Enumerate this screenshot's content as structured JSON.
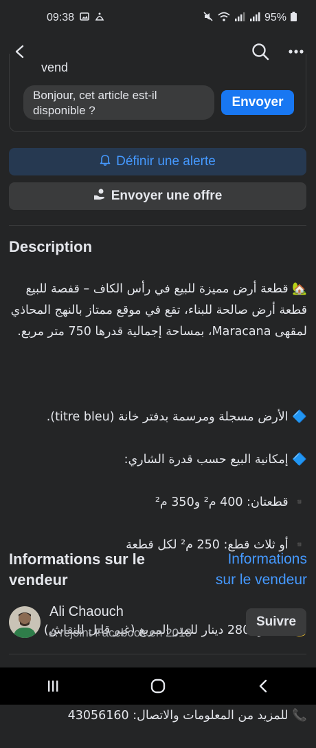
{
  "status_bar": {
    "time": "09:38",
    "battery": "95%"
  },
  "app_bar": {
    "back_icon": "arrow-back-icon",
    "search_icon": "search-icon",
    "more_icon": "more-horizontal-icon"
  },
  "seller_message": {
    "card_label": "vend",
    "message_value": "Bonjour, cet article est-il disponible ?",
    "send_label": "Envoyer"
  },
  "actions": {
    "alert_label": "Définir une alerte",
    "offer_label": "Envoyer une offre"
  },
  "description": {
    "title": "Description",
    "paragraph1": "🏡 قطعة أرض مميزة للبيع في رأس الكاف – قفصة للبيع قطعة أرض صالحة للبناء، تقع في موقع ممتاز بالنهج المحاذي لمقهى Maracana، بمساحة إجمالية قدرها 750 متر مربع.",
    "line_titre": "🔷 الأرض مسجلة ومرسمة بدفتر خانة (titre bleu).",
    "line_possibilite": "🔷 إمكانية البيع حسب قدرة الشاري:",
    "line_two_lots": "▪️ قطعتان: 400 م² و350 م²",
    "line_three_lots": "▪️ أو ثلاث قطع: 250 م² لكل قطعة",
    "line_price": "💰 السعر: 280 دينار للمتر المربع (غير قابل للنقاش)",
    "line_contact": "📞 للمزيد من المعلومات والاتصال: 43056160"
  },
  "seller_info": {
    "title": "Informations sur le vendeur",
    "link": "Informations sur le vendeur",
    "name": "Ali Chaouch",
    "joined": "A rejoint Facebook en 2013",
    "follow_label": "Suivre"
  },
  "colors": {
    "background": "#242526",
    "accent": "#1877f2",
    "link": "#4599ff"
  }
}
